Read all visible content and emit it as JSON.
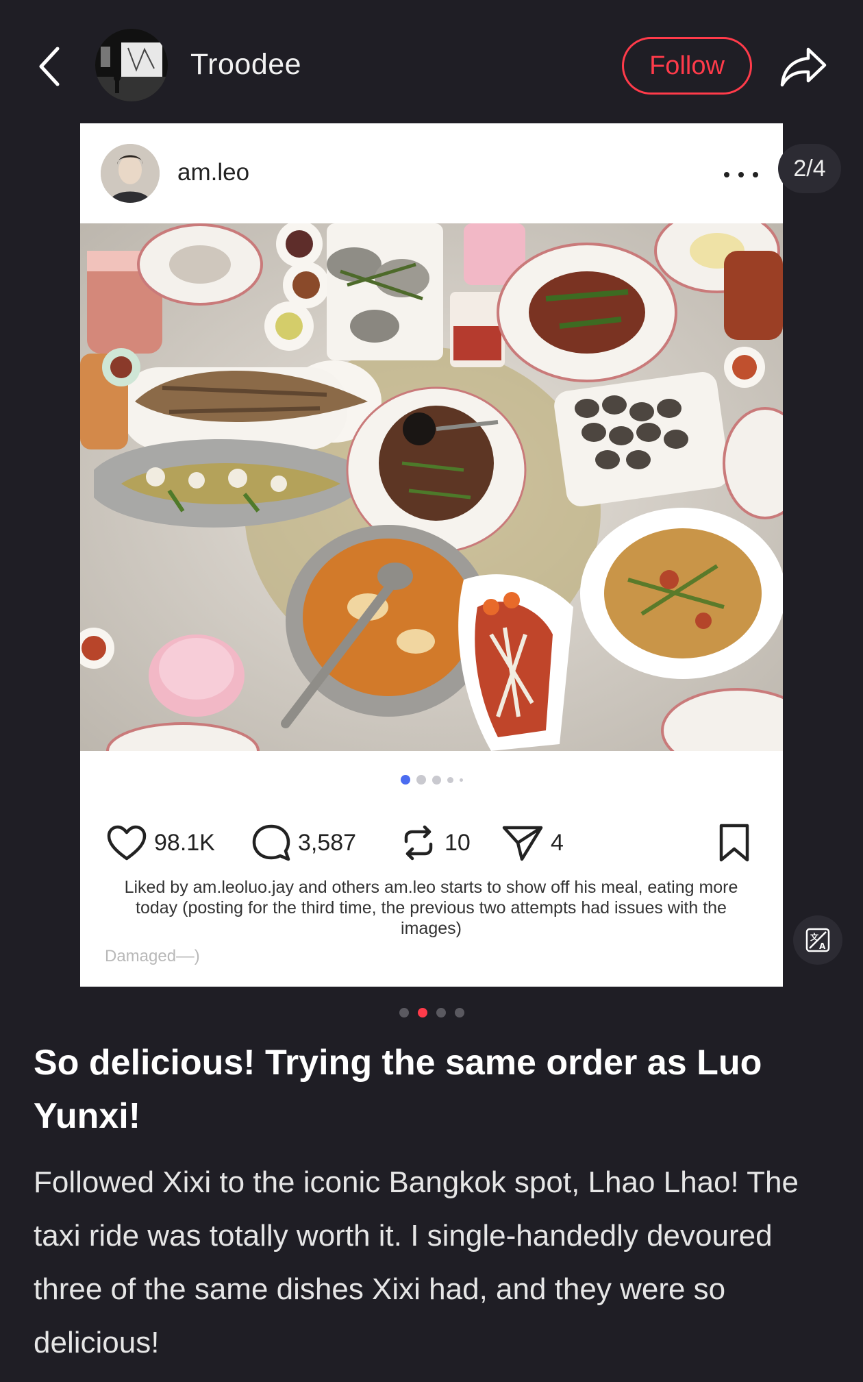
{
  "header": {
    "author_name": "Troodee",
    "follow_label": "Follow",
    "back_icon": "chevron-left-icon",
    "share_icon": "share-arrow-icon"
  },
  "image_pager": {
    "label": "2/4"
  },
  "embedded_post": {
    "username": "am.leo",
    "more_icon": "more-horizontal-icon",
    "photo_description_icon": "food-photo",
    "photo_dots_active_index": 0,
    "stats": {
      "likes": "98.1K",
      "comments": "3,587",
      "reposts": "10",
      "shares": "4"
    },
    "caption": "Liked by am.leoluo.jay and others am.leo starts to show off his meal, eating more today (posting for the third time, the previous two attempts had issues with the images)",
    "damaged_note": "Damaged––)"
  },
  "carousel": {
    "count": 4,
    "active_index": 1
  },
  "post": {
    "title": "So delicious! Trying the same order as Luo Yunxi!",
    "body": "Followed Xixi to the iconic Bangkok spot, Lhao Lhao! The taxi ride was totally worth it. I single-handedly devoured three of the same dishes Xixi had, and they were so delicious!"
  },
  "colors": {
    "background": "#1f1e25",
    "accent": "#ff3b4a",
    "ig_dot_active": "#4b6cf0"
  }
}
